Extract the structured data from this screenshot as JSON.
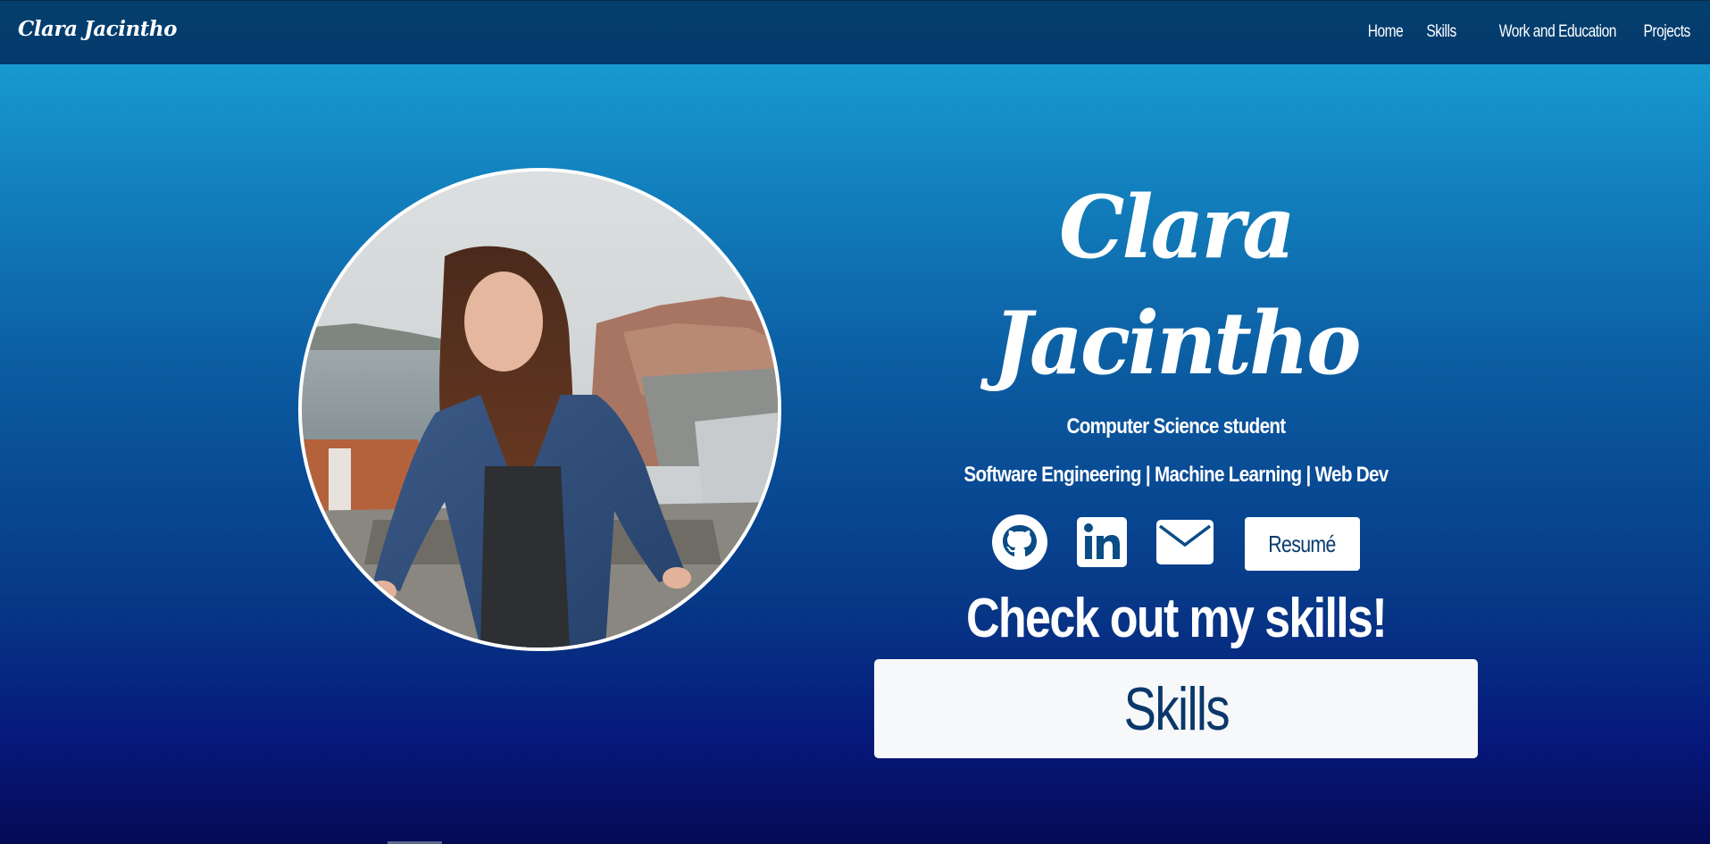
{
  "navbar": {
    "brand": "Clara Jacintho",
    "links": [
      {
        "label": "Home"
      },
      {
        "label": "Skills"
      },
      {
        "label": "Work and Education"
      },
      {
        "label": "Projects"
      }
    ]
  },
  "hero": {
    "name": "Clara Jacintho",
    "subtitle_1": "Computer Science student",
    "subtitle_2": "Software Engineering | Machine Learning | Web Dev",
    "social": [
      {
        "icon": "github-icon"
      },
      {
        "icon": "linkedin-icon"
      },
      {
        "icon": "envelope-icon"
      }
    ],
    "resume_label": "Resumé",
    "cta_heading": "Check out my skills!",
    "skills_button": "Skills"
  },
  "colors": {
    "navbar": "#043c6e",
    "gradient_top": "#1aa7d8",
    "gradient_bottom": "#050a55",
    "button_text": "#0b3769",
    "white": "#ffffff"
  }
}
